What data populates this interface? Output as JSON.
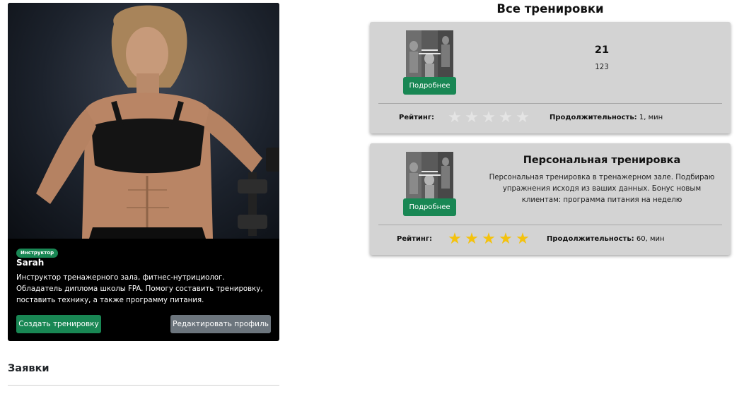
{
  "profile": {
    "badge": "Инструктор",
    "name": "Sarah",
    "bio": "Инструктор тренажерного зала, фитнес-нутрициолог. Обладатель диплома школы FPA. Помогу составить тренировку, поставить технику, а также программу питания.",
    "create_button": "Создать тренировку",
    "edit_button": "Редактировать профиль"
  },
  "requests": {
    "title": "Заявки"
  },
  "workouts": {
    "title": "Все тренировки",
    "details_label": "Подробнее",
    "rating_label": "Рейтинг:",
    "duration_label": "Продолжительность:",
    "items": [
      {
        "title": "21",
        "description": "123",
        "rating": 0,
        "duration_value": "1, мин"
      },
      {
        "title": "Персональная тренировка",
        "description": "Персональная тренировка в тренажерном зале. Подбираю упражнения исходя из ваших данных. Бонус новым клиентам: программа питания на неделю",
        "rating": 5,
        "duration_value": "60, мин"
      }
    ]
  },
  "colors": {
    "primary_green": "#198754",
    "secondary_gray": "#6c757d",
    "card_bg": "#d3d3d3",
    "star_gold": "#f4c20d",
    "star_empty": "#e4e4e4"
  },
  "icons": {
    "star": "star-icon"
  }
}
